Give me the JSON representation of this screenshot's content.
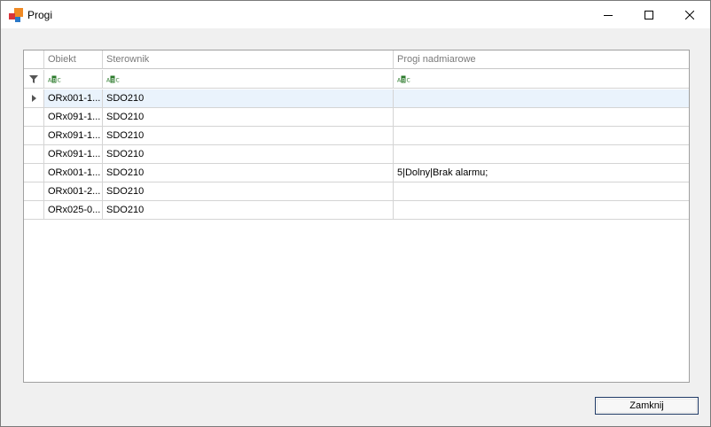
{
  "window": {
    "title": "Progi",
    "icons": {
      "app": "app-logo-icon",
      "minimize": "minimize-icon",
      "maximize": "maximize-icon",
      "close": "close-icon"
    }
  },
  "grid": {
    "columns": [
      "Obiekt",
      "Sterownik",
      "Progi nadmiarowe"
    ],
    "filter_icon": "filter-icon",
    "text_filter_icon": "abc-filter-icon",
    "rows": [
      {
        "obiekt": "ORx001-1...",
        "sterownik": "SDO210",
        "progi": ""
      },
      {
        "obiekt": "ORx091-1...",
        "sterownik": "SDO210",
        "progi": ""
      },
      {
        "obiekt": "ORx091-1...",
        "sterownik": "SDO210",
        "progi": ""
      },
      {
        "obiekt": "ORx091-1...",
        "sterownik": "SDO210",
        "progi": ""
      },
      {
        "obiekt": "ORx001-1...",
        "sterownik": "SDO210",
        "progi": "5|Dolny|Brak alarmu;"
      },
      {
        "obiekt": "ORx001-2...",
        "sterownik": "SDO210",
        "progi": ""
      },
      {
        "obiekt": "ORx025-0...",
        "sterownik": "SDO210",
        "progi": ""
      }
    ],
    "selected_row": 0,
    "colors": {
      "selected_row": "#eaf3fc",
      "grid_line": "#d4d4d4"
    }
  },
  "footer": {
    "close_label": "Zamknij"
  }
}
